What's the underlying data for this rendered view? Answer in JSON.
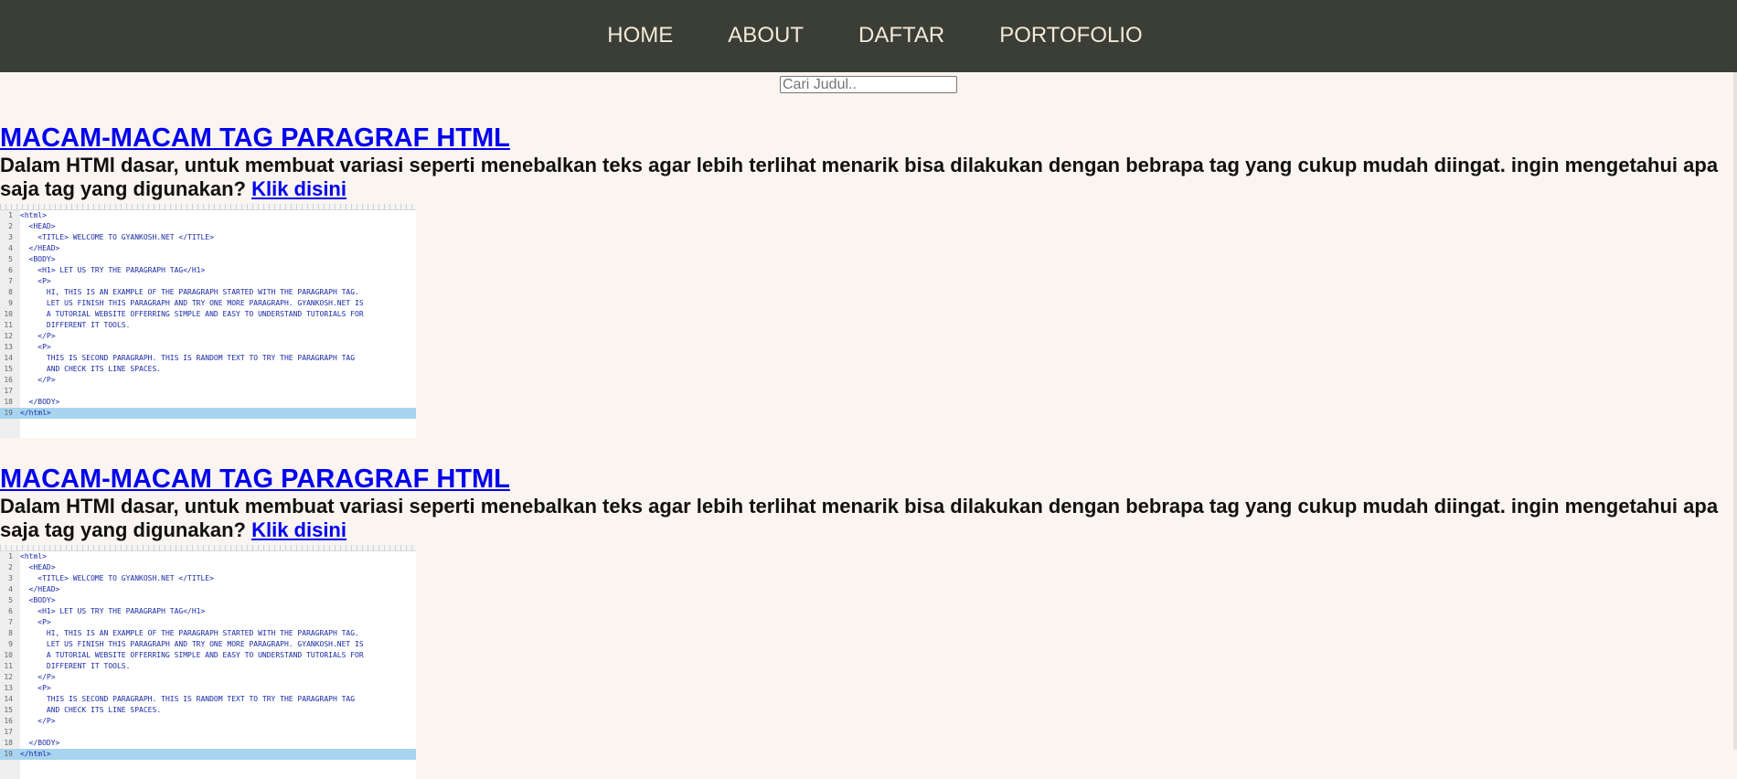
{
  "nav": {
    "items": [
      {
        "label": "HOME"
      },
      {
        "label": "ABOUT"
      },
      {
        "label": "DAFTAR"
      },
      {
        "label": "PORTOFOLIO"
      }
    ]
  },
  "search": {
    "placeholder": "Cari Judul.."
  },
  "articles": [
    {
      "title": "MACAM-MACAM TAG PARAGRAF HTML",
      "description": "Dalam HTMl dasar, untuk membuat variasi seperti menebalkan teks agar lebih terlihat menarik bisa dilakukan dengan bebrapa tag yang cukup mudah diingat. ingin mengetahui apa saja tag yang digunakan?",
      "link_label": "Klik disini"
    },
    {
      "title": "MACAM-MACAM TAG PARAGRAF HTML",
      "description": "Dalam HTMl dasar, untuk membuat variasi seperti menebalkan teks agar lebih terlihat menarik bisa dilakukan dengan bebrapa tag yang cukup mudah diingat. ingin mengetahui apa saja tag yang digunakan?",
      "link_label": "Klik disini"
    }
  ],
  "code_image": {
    "lines": [
      {
        "n": "1",
        "code": "<html>"
      },
      {
        "n": "2",
        "code": "  <HEAD>"
      },
      {
        "n": "3",
        "code": "    <TITLE> WELCOME TO GYANKOSH.NET </TITLE>"
      },
      {
        "n": "4",
        "code": "  </HEAD>"
      },
      {
        "n": "5",
        "code": "  <BODY>"
      },
      {
        "n": "6",
        "code": "    <H1> LET US TRY THE PARAGRAPH TAG</H1>"
      },
      {
        "n": "7",
        "code": "    <P>"
      },
      {
        "n": "8",
        "code": "      HI, THIS IS AN EXAMPLE OF THE PARAGRAPH STARTED WITH THE PARAGRAPH TAG."
      },
      {
        "n": "9",
        "code": "      LET US FINISH THIS PARAGRAPH AND TRY ONE MORE PARAGRAPH. GYANKOSH.NET IS"
      },
      {
        "n": "10",
        "code": "      A TUTORIAL WEBSITE OFFERRING SIMPLE AND EASY TO UNDERSTAND TUTORIALS FOR"
      },
      {
        "n": "11",
        "code": "      DIFFERENT IT TOOLS."
      },
      {
        "n": "12",
        "code": "    </P>"
      },
      {
        "n": "13",
        "code": "    <P>"
      },
      {
        "n": "14",
        "code": "      THIS IS SECOND PARAGRAPH. THIS IS RANDOM TEXT TO TRY THE PARAGRAPH TAG"
      },
      {
        "n": "15",
        "code": "      AND CHECK ITS LINE SPACES."
      },
      {
        "n": "16",
        "code": "    </P>"
      },
      {
        "n": "17",
        "code": ""
      },
      {
        "n": "18",
        "code": "  </BODY>"
      },
      {
        "n": "19",
        "code": "</html>"
      }
    ]
  }
}
